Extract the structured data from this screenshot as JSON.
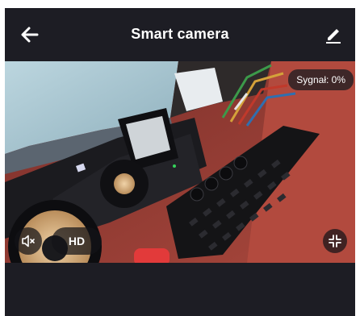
{
  "header": {
    "title": "Smart camera",
    "back_icon": "arrow-left-icon",
    "edit_icon": "pencil-icon"
  },
  "video": {
    "signal_text": "Sygnał: 0%",
    "controls": {
      "mute_icon": "speaker-muted-icon",
      "hd_label": "HD",
      "fullscreen_icon": "fullscreen-exit-icon"
    }
  },
  "colors": {
    "background": "#1d1d24",
    "text": "#ffffff",
    "overlay": "#1e1e22"
  }
}
